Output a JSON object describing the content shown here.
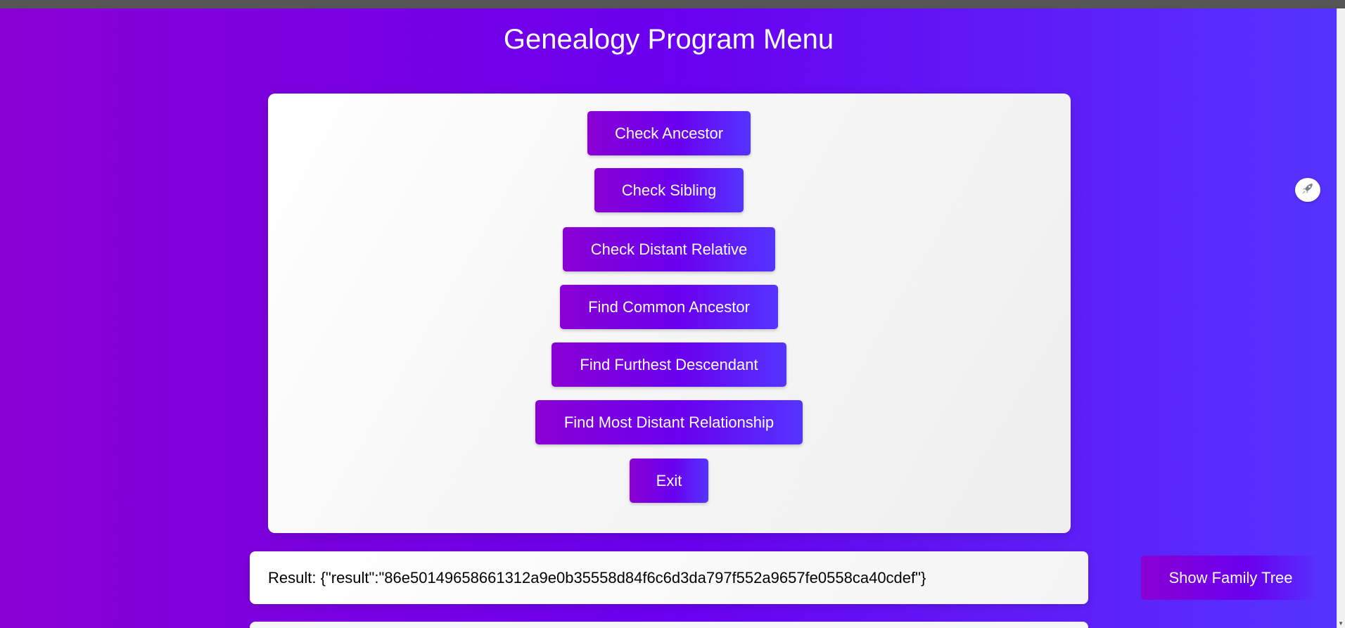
{
  "page": {
    "title": "Genealogy Program Menu"
  },
  "menu": {
    "buttons": [
      {
        "label": "Check Ancestor"
      },
      {
        "label": "Check Sibling"
      },
      {
        "label": "Check Distant Relative"
      },
      {
        "label": "Find Common Ancestor"
      },
      {
        "label": "Find Furthest Descendant"
      },
      {
        "label": "Find Most Distant Relationship"
      },
      {
        "label": "Exit"
      }
    ]
  },
  "result": {
    "text": "Result: {\"result\":\"86e50149658661312a9e0b35558d84f6c6d3da797f552a9657fe0558ca40cdef\"}"
  },
  "actions": {
    "show_tree_label": "Show Family Tree"
  },
  "icons": {
    "side_widget": "rocket-icon"
  },
  "colors": {
    "gradient_start": "#8a00d4",
    "gradient_mid": "#6a00ef",
    "gradient_end": "#5534ff",
    "card_background": "#ffffff",
    "text_on_accent": "#ffffff"
  }
}
